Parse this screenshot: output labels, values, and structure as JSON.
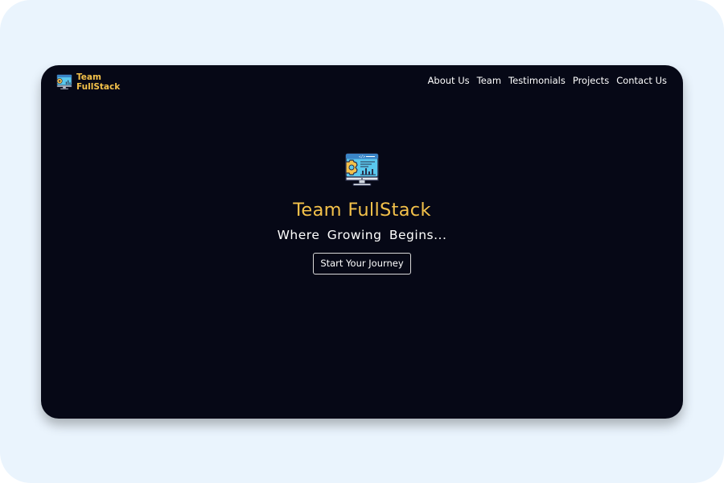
{
  "brand": {
    "line1": "Team",
    "line2": "FullStack",
    "icon": "monitor-gear-icon"
  },
  "nav": {
    "items": [
      {
        "label": "About Us"
      },
      {
        "label": "Team"
      },
      {
        "label": "Testimonials"
      },
      {
        "label": "Projects"
      },
      {
        "label": "Contact Us"
      }
    ]
  },
  "hero": {
    "icon": "monitor-gear-icon",
    "title": "Team FullStack",
    "tagline": "Where Growing Begins...",
    "cta_label": "Start Your Journey"
  },
  "colors": {
    "page_background": "#eaf4fd",
    "window_background": "#060816",
    "accent": "#f3c14a",
    "text": "#ffffff"
  }
}
